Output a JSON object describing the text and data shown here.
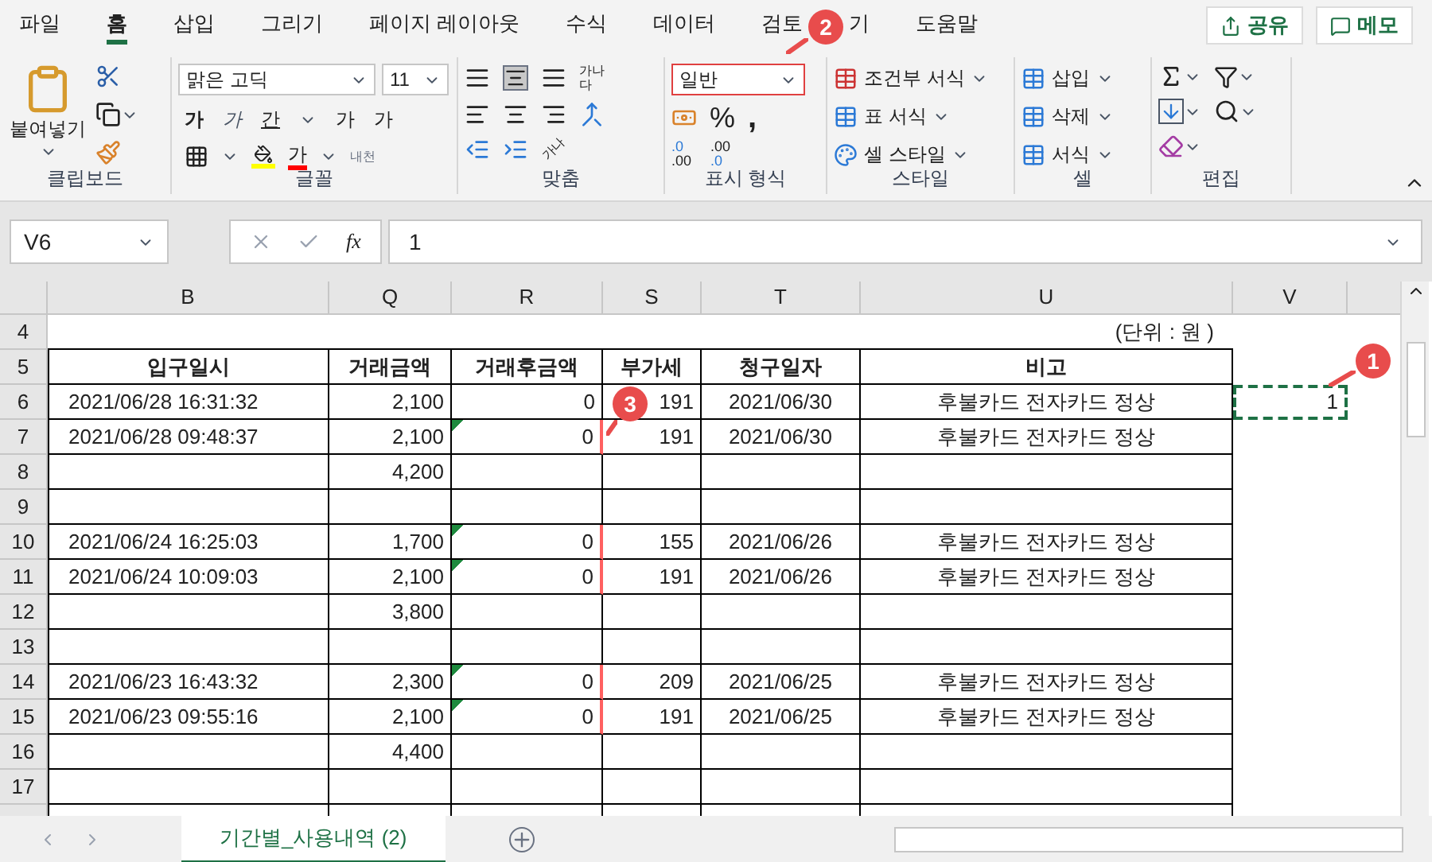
{
  "menu_tabs": [
    {
      "label": "파일",
      "selected": false
    },
    {
      "label": "홈",
      "selected": true
    },
    {
      "label": "삽입",
      "selected": false
    },
    {
      "label": "그리기",
      "selected": false
    },
    {
      "label": "페이지 레이아웃",
      "selected": false
    },
    {
      "label": "수식",
      "selected": false
    },
    {
      "label": "데이터",
      "selected": false
    },
    {
      "label": "검토",
      "selected": false
    },
    {
      "label": "기",
      "selected": false
    },
    {
      "label": "도움말",
      "selected": false
    }
  ],
  "share_button": "공유",
  "memo_button": "메모",
  "clipboard": {
    "paste": "붙여넣기",
    "label": "클립보드"
  },
  "font": {
    "name": "맑은 고딕",
    "size": "11",
    "bold": "가",
    "italic": "가",
    "underline": "간",
    "grow": "가",
    "shrink": "가",
    "color_letter": "가",
    "phonetic": "내천",
    "label": "글꼴"
  },
  "alignment": {
    "wrap_text": "가나다",
    "orientation": "가나",
    "label": "맞춤"
  },
  "number": {
    "format": "일반",
    "percent": "%",
    "comma": ",",
    "more_decimals": [
      ".0",
      ".00"
    ],
    "fewer_decimals": [
      ".00",
      ".0"
    ],
    "label": "표시 형식"
  },
  "styles": {
    "items": [
      "조건부 서식",
      "표 서식",
      "셀 스타일"
    ],
    "label": "스타일"
  },
  "cells": {
    "items": [
      "삽입",
      "삭제",
      "서식"
    ],
    "label": "셀"
  },
  "editing": {
    "label": "편집"
  },
  "formula_bar": {
    "name_box": "V6",
    "fx": "fx",
    "value": "1"
  },
  "columns": [
    "B",
    "Q",
    "R",
    "S",
    "T",
    "U",
    "V"
  ],
  "rows": [
    {
      "row": "4",
      "kind": "note",
      "text": "(단위 : 원 )"
    },
    {
      "row": "5",
      "kind": "header",
      "cells": {
        "B": "입구일시",
        "Q": "거래금액",
        "R": "거래후금액",
        "S": "부가세",
        "T": "청구일자",
        "U": "비고"
      }
    },
    {
      "row": "6",
      "kind": "data",
      "flagged": false,
      "cells": {
        "B": "2021/06/28 16:31:32",
        "Q": "2,100",
        "R": "0",
        "S": "191",
        "T": "2021/06/30",
        "U": "후불카드 전자카드 정상",
        "V": "1"
      }
    },
    {
      "row": "7",
      "kind": "data",
      "flagged": true,
      "cells": {
        "B": "2021/06/28 09:48:37",
        "Q": "2,100",
        "R": "0",
        "S": "191",
        "T": "2021/06/30",
        "U": "후불카드 전자카드 정상"
      }
    },
    {
      "row": "8",
      "kind": "data",
      "flagged": false,
      "cells": {
        "Q": "4,200"
      }
    },
    {
      "row": "9",
      "kind": "data",
      "flagged": false,
      "cells": {}
    },
    {
      "row": "10",
      "kind": "data",
      "flagged": true,
      "cells": {
        "B": "2021/06/24 16:25:03",
        "Q": "1,700",
        "R": "0",
        "S": "155",
        "T": "2021/06/26",
        "U": "후불카드 전자카드 정상"
      }
    },
    {
      "row": "11",
      "kind": "data",
      "flagged": true,
      "cells": {
        "B": "2021/06/24 10:09:03",
        "Q": "2,100",
        "R": "0",
        "S": "191",
        "T": "2021/06/26",
        "U": "후불카드 전자카드 정상"
      }
    },
    {
      "row": "12",
      "kind": "data",
      "flagged": false,
      "cells": {
        "Q": "3,800"
      }
    },
    {
      "row": "13",
      "kind": "data",
      "flagged": false,
      "cells": {}
    },
    {
      "row": "14",
      "kind": "data",
      "flagged": true,
      "cells": {
        "B": "2021/06/23 16:43:32",
        "Q": "2,300",
        "R": "0",
        "S": "209",
        "T": "2021/06/25",
        "U": "후불카드 전자카드 정상"
      }
    },
    {
      "row": "15",
      "kind": "data",
      "flagged": true,
      "cells": {
        "B": "2021/06/23 09:55:16",
        "Q": "2,100",
        "R": "0",
        "S": "191",
        "T": "2021/06/25",
        "U": "후불카드 전자카드 정상"
      }
    },
    {
      "row": "16",
      "kind": "data",
      "flagged": false,
      "cells": {
        "Q": "4,400"
      }
    },
    {
      "row": "17",
      "kind": "data",
      "flagged": false,
      "cells": {}
    }
  ],
  "sheet_tabs": [
    {
      "label": "기간별_사용내역 (2)",
      "selected": true
    }
  ],
  "callouts": [
    "1",
    "2",
    "3"
  ]
}
